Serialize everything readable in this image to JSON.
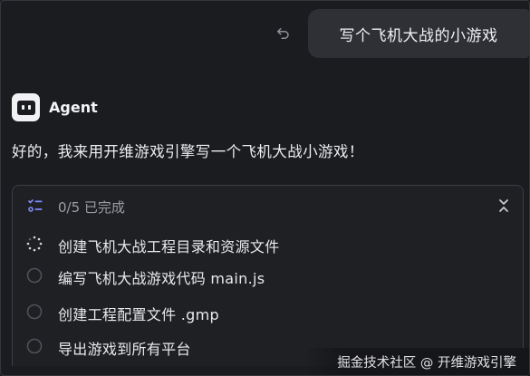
{
  "user_message": {
    "text": "写个飞机大战的小游戏",
    "undo_icon": "undo-icon"
  },
  "agent": {
    "name": "Agent",
    "avatar_icon": "agent-bot-icon",
    "reply": "好的，我来用开维游戏引擎写一个飞机大战小游戏！"
  },
  "tasks": {
    "progress": "0/5 已完成",
    "header_icon": "checklist-icon",
    "collapse_icon": "chevron-collapse-icon",
    "items": [
      {
        "label": "创建飞机大战工程目录和资源文件",
        "status": "in-progress"
      },
      {
        "label": "编写飞机大战游戏代码 main.js",
        "status": "pending"
      },
      {
        "label": "创建工程配置文件 .gmp",
        "status": "pending"
      },
      {
        "label": "导出游戏到所有平台",
        "status": "pending"
      }
    ]
  },
  "watermark": "掘金技术社区 @ 开维游戏引擎",
  "colors": {
    "background": "#1b1c20",
    "bubble": "#2e3035",
    "panel": "#1f2024",
    "accent_icon": "#7f8cff"
  }
}
